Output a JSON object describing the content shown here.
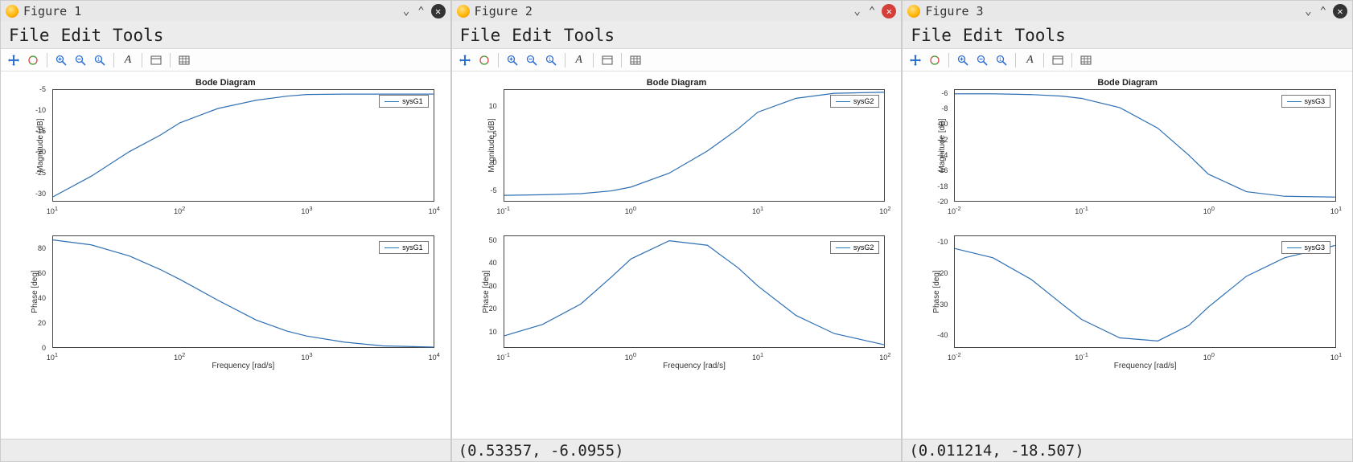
{
  "windows": [
    {
      "title": "Figure 1",
      "close_style": "black",
      "menus": [
        "File",
        "Edit",
        "Tools"
      ],
      "status": "",
      "chart_title": "Bode Diagram",
      "legend": "sysG1",
      "xlabel": "Frequency [rad/s]",
      "mag_ylabel": "Magnitude [dB]",
      "phase_ylabel": "Phase [deg]"
    },
    {
      "title": "Figure 2",
      "close_style": "red",
      "menus": [
        "File",
        "Edit",
        "Tools"
      ],
      "status": "(0.53357, -6.0955)",
      "chart_title": "Bode Diagram",
      "legend": "sysG2",
      "xlabel": "Frequency [rad/s]",
      "mag_ylabel": "Magnitude [dB]",
      "phase_ylabel": "Phase [deg]"
    },
    {
      "title": "Figure 3",
      "close_style": "black",
      "menus": [
        "File",
        "Edit",
        "Tools"
      ],
      "status": "(0.011214, -18.507)",
      "chart_title": "Bode Diagram",
      "legend": "sysG3",
      "xlabel": "Frequency [rad/s]",
      "mag_ylabel": "Magnitude [dB]",
      "phase_ylabel": "Phase [deg]"
    }
  ],
  "toolbar_icons": [
    "pan-icon",
    "rotate-icon",
    "zoom-in-icon",
    "zoom-out-icon",
    "zoom-reset-icon",
    "text-icon",
    "box-icon",
    "grid-icon"
  ],
  "chart_data": [
    {
      "window": "Figure 1",
      "type": "line",
      "title": "Bode Diagram",
      "xlabel": "Frequency [rad/s]",
      "x_scale": "log",
      "subplots": [
        {
          "name": "Magnitude",
          "ylabel": "Magnitude [dB]",
          "ylim": [
            -32,
            -5
          ],
          "yticks": [
            -30,
            -25,
            -20,
            -15,
            -10,
            -5
          ],
          "xlim": [
            10,
            10000
          ],
          "xticks": [
            10,
            100,
            1000,
            10000
          ],
          "series": [
            {
              "name": "sysG1",
              "x": [
                10,
                20,
                40,
                70,
                100,
                200,
                400,
                700,
                1000,
                2000,
                4000,
                10000
              ],
              "y": [
                -31,
                -26,
                -20,
                -16,
                -13,
                -9.5,
                -7.5,
                -6.5,
                -6.1,
                -6,
                -6,
                -6
              ]
            }
          ]
        },
        {
          "name": "Phase",
          "ylabel": "Phase [deg]",
          "ylim": [
            0,
            90
          ],
          "yticks": [
            0,
            20,
            40,
            60,
            80
          ],
          "xlim": [
            10,
            10000
          ],
          "xticks": [
            10,
            100,
            1000,
            10000
          ],
          "series": [
            {
              "name": "sysG1",
              "x": [
                10,
                20,
                40,
                70,
                100,
                200,
                400,
                700,
                1000,
                2000,
                4000,
                10000
              ],
              "y": [
                87,
                83,
                74,
                63,
                55,
                38,
                22,
                13,
                9,
                4,
                1,
                0
              ]
            }
          ]
        }
      ]
    },
    {
      "window": "Figure 2",
      "type": "line",
      "title": "Bode Diagram",
      "xlabel": "Frequency [rad/s]",
      "x_scale": "log",
      "subplots": [
        {
          "name": "Magnitude",
          "ylabel": "Magnitude [dB]",
          "ylim": [
            -7,
            13
          ],
          "yticks": [
            -5,
            0,
            5,
            10
          ],
          "xlim": [
            0.1,
            100
          ],
          "xticks": [
            0.1,
            1,
            10,
            100
          ],
          "series": [
            {
              "name": "sysG2",
              "x": [
                0.1,
                0.2,
                0.4,
                0.7,
                1,
                2,
                4,
                7,
                10,
                20,
                40,
                100
              ],
              "y": [
                -6,
                -5.9,
                -5.7,
                -5.2,
                -4.5,
                -2,
                2,
                6,
                9,
                11.5,
                12.4,
                12.6
              ]
            }
          ]
        },
        {
          "name": "Phase",
          "ylabel": "Phase [deg]",
          "ylim": [
            3,
            52
          ],
          "yticks": [
            10,
            20,
            30,
            40,
            50
          ],
          "xlim": [
            0.1,
            100
          ],
          "xticks": [
            0.1,
            1,
            10,
            100
          ],
          "series": [
            {
              "name": "sysG2",
              "x": [
                0.1,
                0.2,
                0.4,
                0.7,
                1,
                2,
                4,
                7,
                10,
                20,
                40,
                100
              ],
              "y": [
                8,
                13,
                22,
                34,
                42,
                50,
                48,
                38,
                30,
                17,
                9,
                4
              ]
            }
          ]
        }
      ]
    },
    {
      "window": "Figure 3",
      "type": "line",
      "title": "Bode Diagram",
      "xlabel": "Frequency [rad/s]",
      "x_scale": "log",
      "subplots": [
        {
          "name": "Magnitude",
          "ylabel": "Magnitude [dB]",
          "ylim": [
            -20,
            -5.5
          ],
          "yticks": [
            -20,
            -18,
            -16,
            -14,
            -12,
            -10,
            -8,
            -6
          ],
          "xlim": [
            0.01,
            10
          ],
          "xticks": [
            0.01,
            0.1,
            1,
            10
          ],
          "series": [
            {
              "name": "sysG3",
              "x": [
                0.01,
                0.02,
                0.04,
                0.07,
                0.1,
                0.2,
                0.4,
                0.7,
                1,
                2,
                4,
                10
              ],
              "y": [
                -6,
                -6,
                -6.1,
                -6.3,
                -6.6,
                -7.8,
                -10.5,
                -14,
                -16.5,
                -18.8,
                -19.4,
                -19.5
              ]
            }
          ]
        },
        {
          "name": "Phase",
          "ylabel": "Phase [deg]",
          "ylim": [
            -44,
            -8
          ],
          "yticks": [
            -40,
            -30,
            -20,
            -10
          ],
          "xlim": [
            0.01,
            10
          ],
          "xticks": [
            0.01,
            0.1,
            1,
            10
          ],
          "series": [
            {
              "name": "sysG3",
              "x": [
                0.01,
                0.02,
                0.04,
                0.07,
                0.1,
                0.2,
                0.4,
                0.7,
                1,
                2,
                4,
                10
              ],
              "y": [
                -12,
                -15,
                -22,
                -30,
                -35,
                -41,
                -42,
                -37,
                -31,
                -21,
                -15,
                -11
              ]
            }
          ]
        }
      ]
    }
  ]
}
